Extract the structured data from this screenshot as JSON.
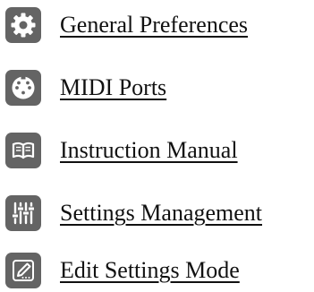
{
  "menu": {
    "items": [
      {
        "label": "General Preferences",
        "icon": "gear-icon"
      },
      {
        "label": "MIDI Ports",
        "icon": "midi-port-icon"
      },
      {
        "label": "Instruction Manual",
        "icon": "book-icon"
      },
      {
        "label": "Settings Management",
        "icon": "sliders-icon"
      },
      {
        "label": "Edit Settings Mode",
        "icon": "pencil-square-icon"
      }
    ]
  },
  "colors": {
    "icon_background": "#646464",
    "icon_foreground": "#ffffff",
    "text": "#111111"
  }
}
